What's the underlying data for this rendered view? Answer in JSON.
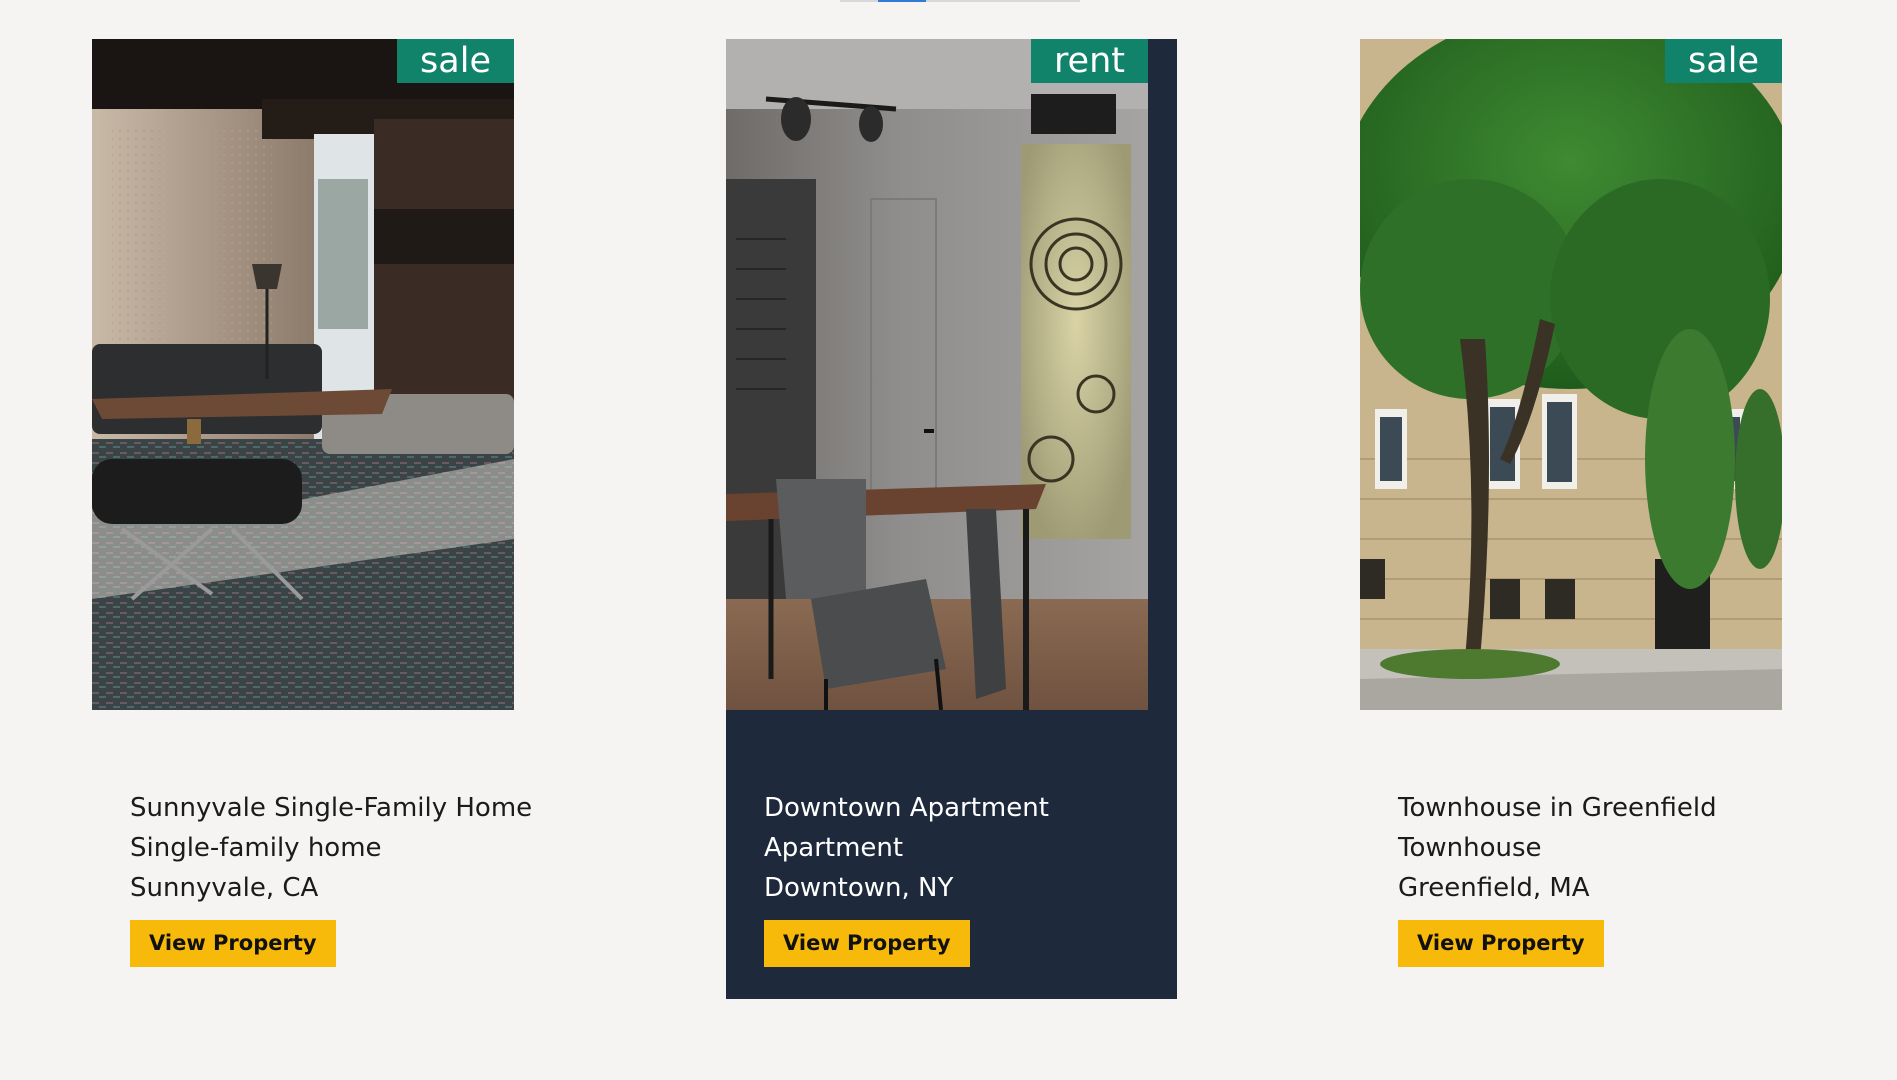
{
  "slider": {
    "position": 0.2
  },
  "listings": [
    {
      "badge": "sale",
      "title": "Sunnyvale Single-Family Home",
      "type": "Single-family home",
      "location": "Sunnyvale, CA",
      "button_label": "View Property",
      "image_subject": "living-room-photo"
    },
    {
      "badge": "rent",
      "title": "Downtown Apartment",
      "type": "Apartment",
      "location": "Downtown, NY",
      "button_label": "View Property",
      "image_subject": "apartment-dining-photo"
    },
    {
      "badge": "sale",
      "title": "Townhouse in Greenfield",
      "type": "Townhouse",
      "location": "Greenfield, MA",
      "button_label": "View Property",
      "image_subject": "townhouse-tree-photo"
    }
  ],
  "colors": {
    "background": "#f5f4f2",
    "badge": "#10836a",
    "button": "#f7b90a",
    "highlight_card": "#1e293b"
  }
}
